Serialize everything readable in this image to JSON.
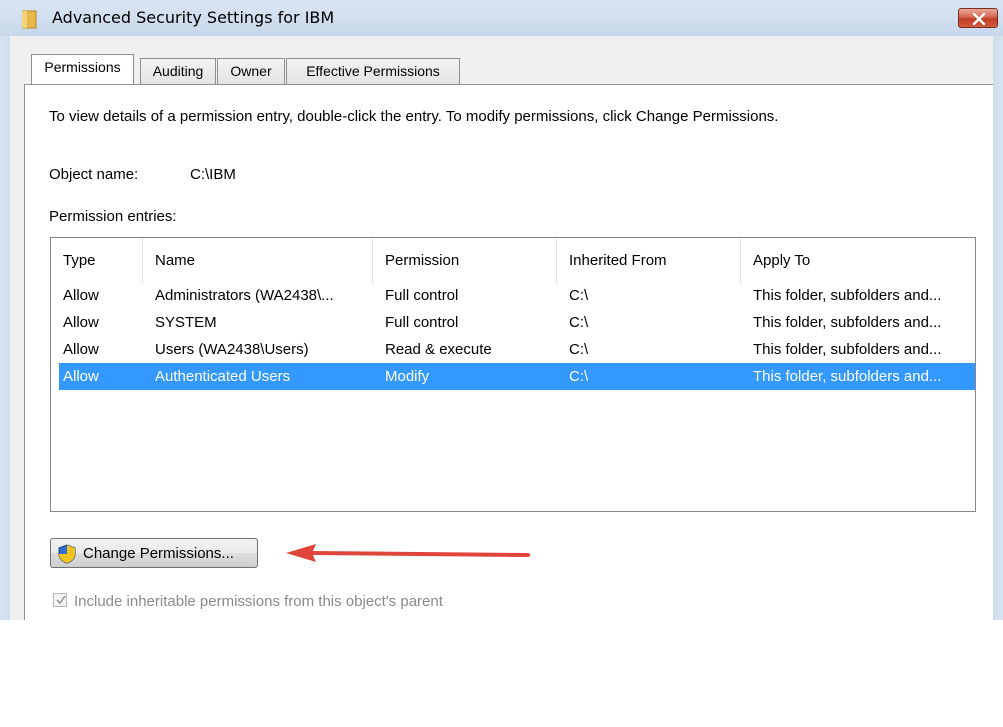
{
  "window": {
    "title": "Advanced Security Settings for IBM"
  },
  "tabs": [
    {
      "label": "Permissions",
      "active": true
    },
    {
      "label": "Auditing",
      "active": false
    },
    {
      "label": "Owner",
      "active": false
    },
    {
      "label": "Effective Permissions",
      "active": false
    }
  ],
  "panel": {
    "instructions": "To view details of a permission entry, double-click the entry. To modify permissions, click Change Permissions.",
    "object_name_label": "Object name:",
    "object_name_value": "C:\\IBM",
    "entries_label": "Permission entries:"
  },
  "table": {
    "columns": [
      "Type",
      "Name",
      "Permission",
      "Inherited From",
      "Apply To"
    ],
    "rows": [
      [
        "Allow",
        "Administrators (WA2438\\...",
        "Full control",
        "C:\\",
        "This folder, subfolders and..."
      ],
      [
        "Allow",
        "SYSTEM",
        "Full control",
        "C:\\",
        "This folder, subfolders and..."
      ],
      [
        "Allow",
        "Users (WA2438\\Users)",
        "Read & execute",
        "C:\\",
        "This folder, subfolders and..."
      ],
      [
        "Allow",
        "Authenticated Users",
        "Modify",
        "C:\\",
        "This folder, subfolders and..."
      ]
    ],
    "selected_row": 3
  },
  "change_button": {
    "label": "Change Permissions...",
    "icon": "uac-shield-icon"
  },
  "inherit_checkbox": {
    "label": "Include inheritable permissions from this object's parent",
    "checked": true,
    "disabled": true
  },
  "colors": {
    "selection": "#3399ff",
    "annotation_arrow": "#e0453a"
  }
}
